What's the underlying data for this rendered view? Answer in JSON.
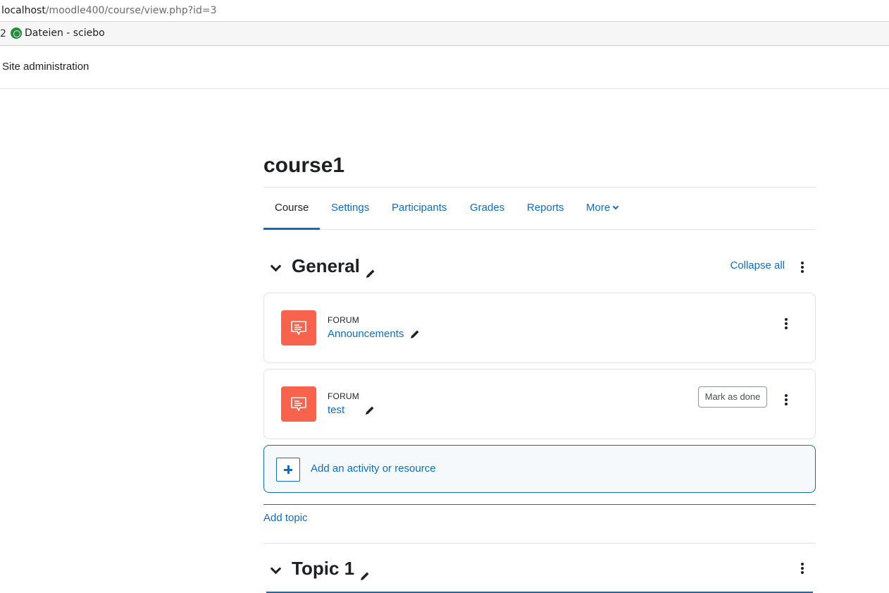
{
  "browser": {
    "url_host": "localhost",
    "url_path": "/moodle400/course/view.php?id=3",
    "bookmarks_prefix": "2",
    "bookmark_label": "Dateien - sciebo"
  },
  "topnav": {
    "item": "Site administration"
  },
  "course": {
    "title": "course1",
    "tabs": [
      {
        "label": "Course"
      },
      {
        "label": "Settings"
      },
      {
        "label": "Participants"
      },
      {
        "label": "Grades"
      },
      {
        "label": "Reports"
      },
      {
        "label": "More"
      }
    ],
    "active_tab": "Course",
    "collapse_all": "Collapse all",
    "sections": [
      {
        "title": "General"
      },
      {
        "title": "Topic 1"
      }
    ],
    "activities": [
      {
        "type": "FORUM",
        "name": "Announcements"
      },
      {
        "type": "FORUM",
        "name": "test",
        "button": "Mark as done"
      }
    ],
    "add_activity": "Add an activity or resource",
    "add_topic": "Add topic"
  },
  "colors": {
    "link": "#0f6cbf",
    "forum_icon_bg": "#f7634d",
    "text": "#1d2125"
  }
}
